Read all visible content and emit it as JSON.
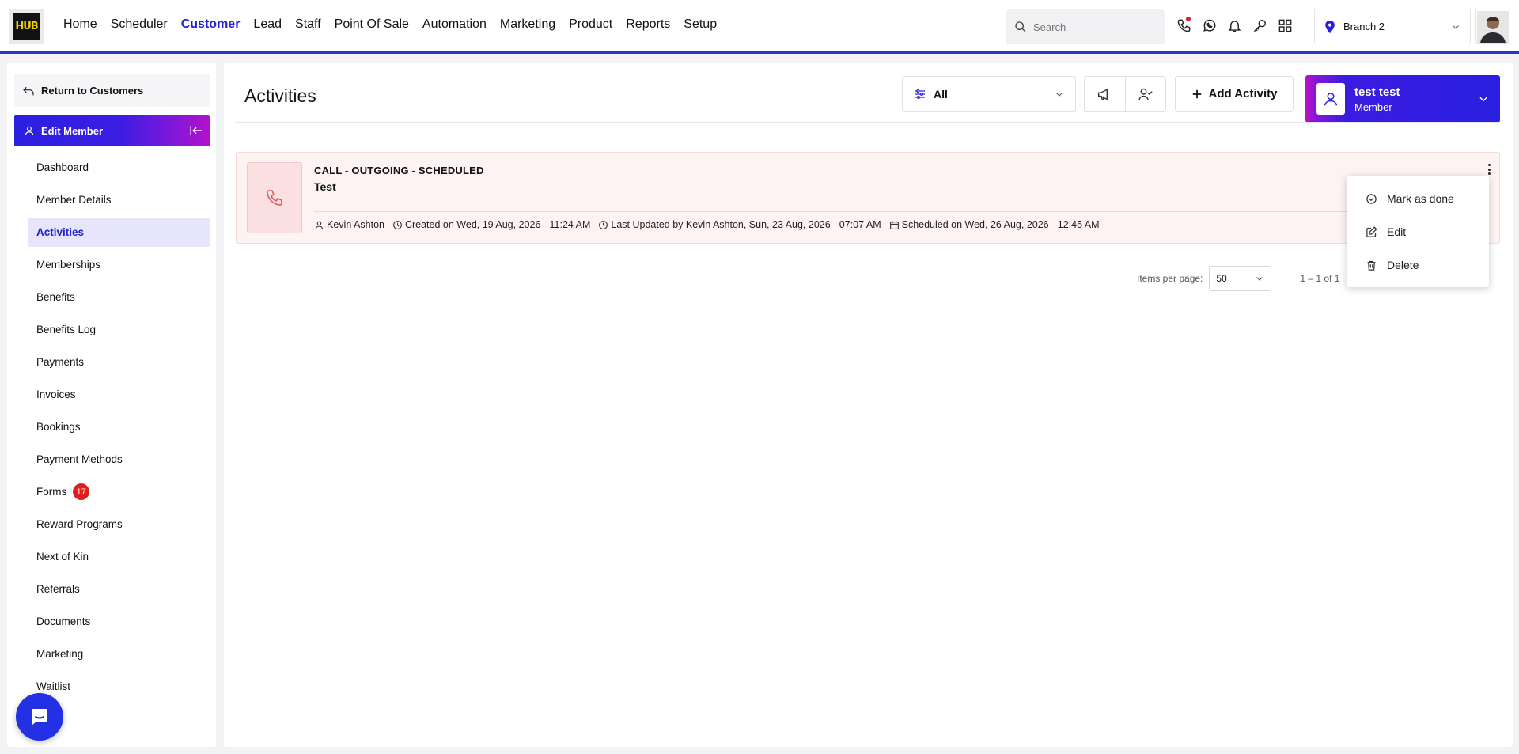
{
  "brand": {
    "logo_text": "HUB"
  },
  "nav": {
    "items": [
      "Home",
      "Scheduler",
      "Customer",
      "Lead",
      "Staff",
      "Point Of Sale",
      "Automation",
      "Marketing",
      "Product",
      "Reports",
      "Setup"
    ],
    "active": "Customer"
  },
  "search": {
    "placeholder": "Search"
  },
  "branch": {
    "label": "Branch 2"
  },
  "sidebar": {
    "return_label": "Return to Customers",
    "section_label": "Edit Member",
    "items": [
      {
        "label": "Dashboard"
      },
      {
        "label": "Member Details"
      },
      {
        "label": "Activities"
      },
      {
        "label": "Memberships"
      },
      {
        "label": "Benefits"
      },
      {
        "label": "Benefits Log"
      },
      {
        "label": "Payments"
      },
      {
        "label": "Invoices"
      },
      {
        "label": "Bookings"
      },
      {
        "label": "Payment Methods"
      },
      {
        "label": "Forms",
        "badge": "17"
      },
      {
        "label": "Reward Programs"
      },
      {
        "label": "Next of Kin"
      },
      {
        "label": "Referrals"
      },
      {
        "label": "Documents"
      },
      {
        "label": "Marketing"
      },
      {
        "label": "Waitlist"
      }
    ],
    "active": "Activities"
  },
  "main": {
    "title": "Activities",
    "filter_value": "All",
    "add_activity_label": "Add Activity",
    "member": {
      "name": "test test",
      "role": "Member"
    }
  },
  "activity": {
    "type": "CALL - OUTGOING - SCHEDULED",
    "subject": "Test",
    "owner": "Kevin Ashton",
    "created": "Created on Wed, 19 Aug, 2026 - 11:24 AM",
    "updated": "Last Updated by Kevin Ashton, Sun, 23 Aug, 2026 - 07:07 AM",
    "scheduled": "Scheduled on Wed, 26 Aug, 2026 - 12:45 AM"
  },
  "paginator": {
    "label": "Items per page:",
    "page_size": "50",
    "range": "1 – 1 of 1"
  },
  "actions_menu": {
    "items": [
      "Mark as done",
      "Edit",
      "Delete"
    ]
  },
  "colors": {
    "accent": "#2323d6",
    "badge": "#e01e1e",
    "activity_icon": "#e05a5a"
  }
}
